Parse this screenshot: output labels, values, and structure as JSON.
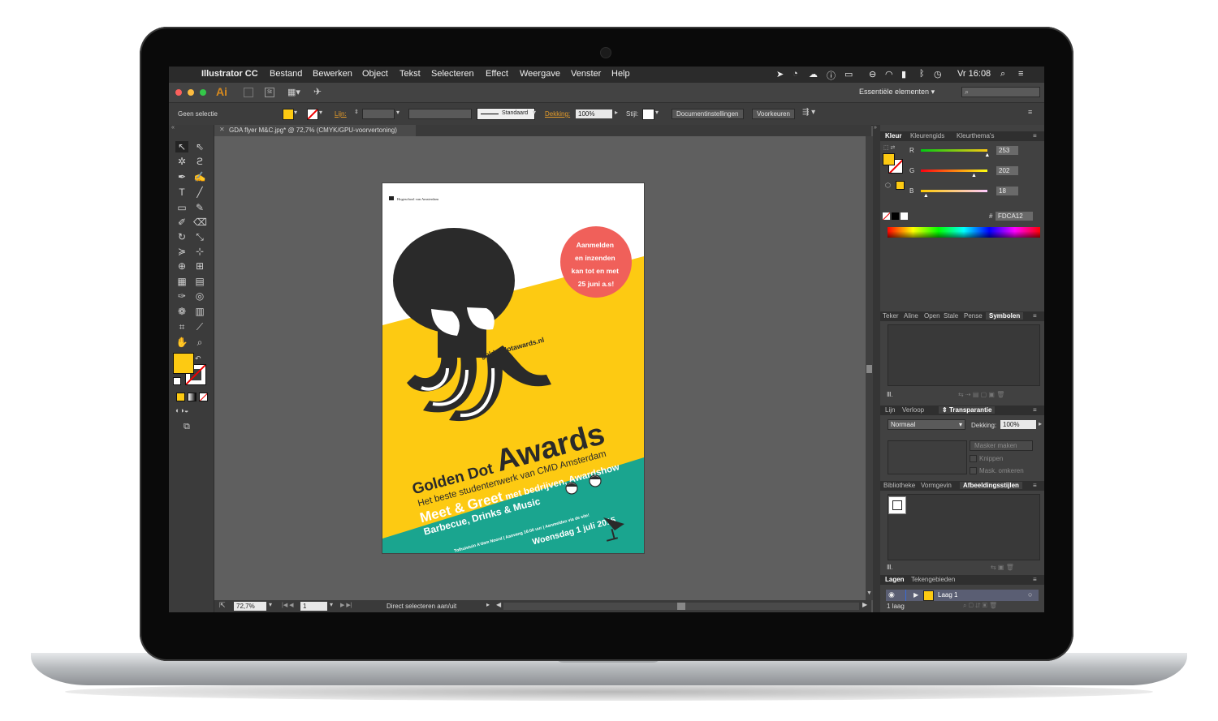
{
  "menubar": {
    "apple": "",
    "items": [
      "Illustrator CC",
      "Bestand",
      "Bewerken",
      "Object",
      "Tekst",
      "Selecteren",
      "Effect",
      "Weergave",
      "Venster",
      "Help"
    ],
    "clock": "Vr 16:08"
  },
  "appbar": {
    "app_icon": "Ai",
    "workspace": "Essentiële elementen",
    "search_placeholder": ""
  },
  "control_bar": {
    "selection": "Geen selectie",
    "fill_color": "#FDCA12",
    "stroke_label": "Lijn:",
    "profile": "Standaard",
    "opacity_label": "Dekking:",
    "opacity": "100%",
    "style_label": "Stijl:",
    "document_settings": "Documentinstellingen",
    "preferences": "Voorkeuren"
  },
  "document_tab": "GDA flyer M&C.jpg* @ 72,7% (CMYK/GPU-voorvertoning)",
  "status_bar": {
    "zoom": "72,7%",
    "artboard": "1",
    "tool_status": "Direct selecteren aan/uit"
  },
  "color_panel": {
    "tabs": [
      "Kleur",
      "Kleurengids",
      "Kleurthema's"
    ],
    "channels": [
      {
        "label": "R",
        "value": "253",
        "level": 0.992
      },
      {
        "label": "G",
        "value": "202",
        "level": 0.792
      },
      {
        "label": "B",
        "value": "18",
        "level": 0.071
      }
    ],
    "hex_label": "#",
    "hex": "FDCA12"
  },
  "symbols_panel": {
    "tabs": [
      "Teker",
      "Aline",
      "Open",
      "Stale",
      "Pense",
      "Symbolen"
    ]
  },
  "transparency_panel": {
    "tabs": [
      "Lijn",
      "Verloop",
      "Transparantie"
    ],
    "blend_mode": "Normaal",
    "opacity_label": "Dekking:",
    "opacity": "100%",
    "make_mask": "Masker maken",
    "clip": "Knippen",
    "invert_mask": "Mask. omkeren"
  },
  "graphic_styles_panel": {
    "tabs": [
      "Bibliotheke",
      "Vormgevin",
      "Afbeeldingsstijlen"
    ]
  },
  "layers_panel": {
    "tabs": [
      "Lagen",
      "Tekengebieden"
    ],
    "layers": [
      {
        "name": "Laag 1"
      }
    ],
    "count": "1 laag"
  },
  "poster": {
    "school": "Hogeschool van Amsterdam",
    "badge_lines": [
      "Aanmelden",
      "en inzenden",
      "kan tot en met",
      "25 juni a.s!"
    ],
    "url": "goldendotawards.nl",
    "title_small": "Golden Dot",
    "title_big": "Awards",
    "subtitle": "Het beste studentenwerk van CMD Amsterdam",
    "meet_greet": "Meet & Greet",
    "meet_rest": " met bedrijven, Awardshow",
    "bbq": "Barbecue, Drinks & Music",
    "venue": "Tolhuistuin A'dam Noord  |  Aanvang 16:00 uur  |  Aanmelden via de site!",
    "date": "Woensdag 1 juli 2015",
    "colors": {
      "yellow": "#FDCA12",
      "teal": "#1AA58F",
      "red": "#F0605A",
      "ink": "#2A2A2A"
    }
  }
}
